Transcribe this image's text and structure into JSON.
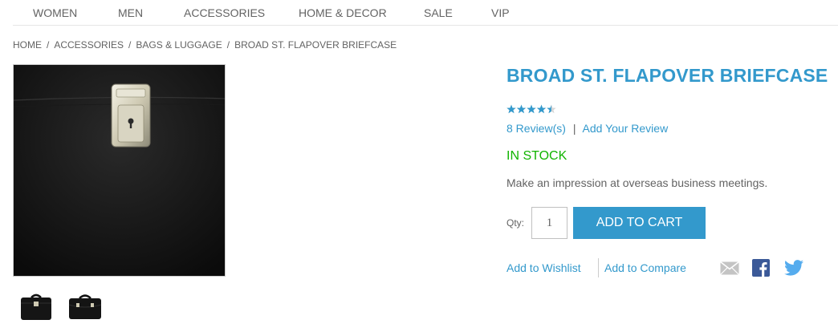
{
  "nav": {
    "items": [
      {
        "label": "WOMEN"
      },
      {
        "label": "MEN"
      },
      {
        "label": "ACCESSORIES"
      },
      {
        "label": "HOME & DECOR"
      },
      {
        "label": "SALE"
      },
      {
        "label": "VIP"
      }
    ]
  },
  "breadcrumb": {
    "items": [
      {
        "label": "HOME"
      },
      {
        "label": "ACCESSORIES"
      },
      {
        "label": "BAGS & LUGGAGE"
      },
      {
        "label": "BROAD ST. FLAPOVER BRIEFCASE"
      }
    ],
    "separator": "/"
  },
  "product": {
    "title": "BROAD ST. FLAPOVER BRIEFCASE",
    "rating_fraction": 0.9,
    "reviews_link": "8 Review(s)",
    "review_separator": "|",
    "add_review_link": "Add Your Review",
    "stock": "IN STOCK",
    "description": "Make an impression at overseas business meetings.",
    "qty_label": "Qty:",
    "qty_value": "1",
    "add_to_cart": "ADD TO CART",
    "wishlist_link": "Add to Wishlist",
    "compare_link": "Add to Compare"
  },
  "share": {
    "icons": [
      "email-icon",
      "facebook-icon",
      "twitter-icon"
    ]
  },
  "colors": {
    "accent": "#3399cc",
    "in_stock": "#11b400",
    "text": "#636363"
  }
}
